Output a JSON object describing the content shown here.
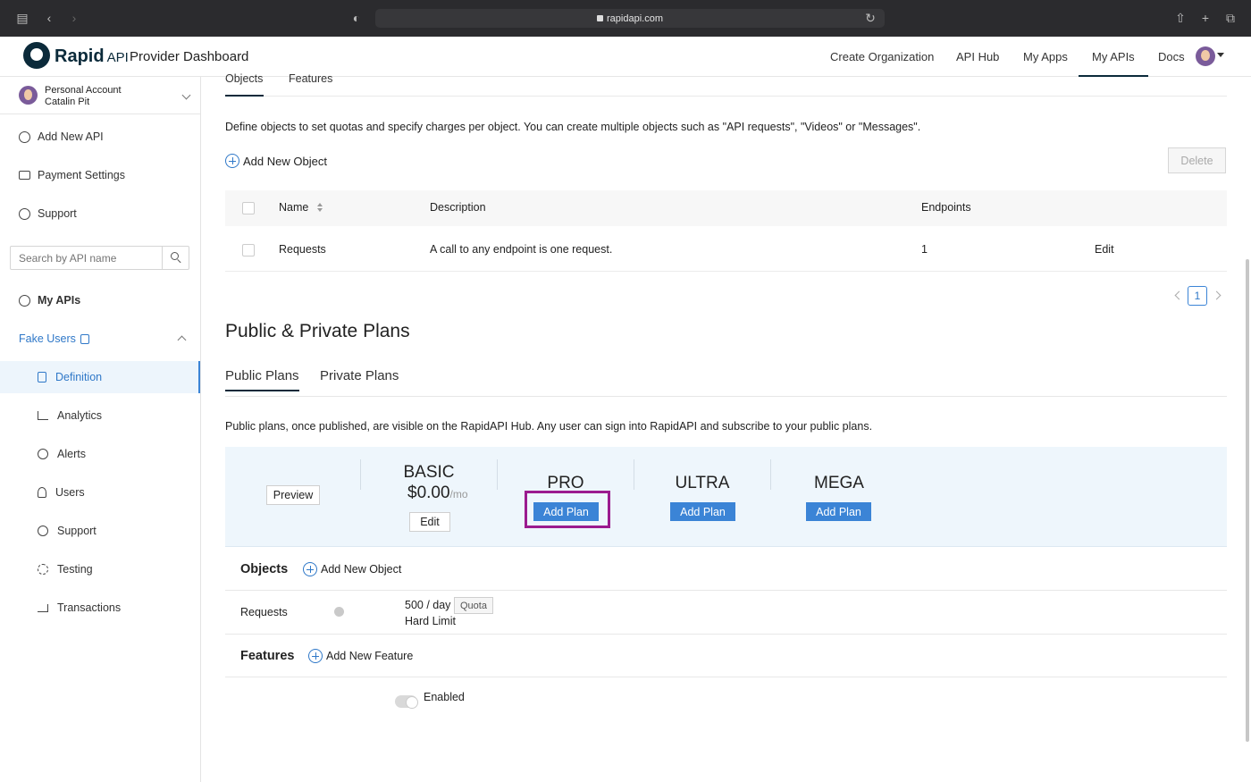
{
  "browser": {
    "url": "rapidapi.com"
  },
  "header": {
    "brand": "Rapid",
    "brand_suffix": "API",
    "title": "Provider Dashboard",
    "nav": [
      "Create Organization",
      "API Hub",
      "My Apps",
      "My APIs",
      "Docs"
    ],
    "active_nav": "My APIs"
  },
  "sidebar": {
    "account_type": "Personal Account",
    "account_name": "Catalin Pit",
    "top_items": [
      "Add New API",
      "Payment Settings",
      "Support"
    ],
    "search_placeholder": "Search by API name",
    "my_apis": "My APIs",
    "api_name": "Fake Users",
    "sub_items": [
      "Definition",
      "Analytics",
      "Alerts",
      "Users",
      "Support",
      "Testing",
      "Transactions"
    ],
    "active_sub": "Definition"
  },
  "objects_section": {
    "tabs": [
      "Objects",
      "Features"
    ],
    "description": "Define objects to set quotas and specify charges per object. You can create multiple objects such as \"API requests\", \"Videos\" or \"Messages\".",
    "add_label": "Add New Object",
    "delete_label": "Delete",
    "columns": [
      "Name",
      "Description",
      "Endpoints"
    ],
    "rows": [
      {
        "name": "Requests",
        "description": "A call to any endpoint is one request.",
        "endpoints": "1",
        "action": "Edit"
      }
    ],
    "page": "1"
  },
  "plans_section": {
    "title": "Public & Private Plans",
    "tabs": [
      "Public Plans",
      "Private Plans"
    ],
    "active_tab": "Public Plans",
    "description": "Public plans, once published, are visible on the RapidAPI Hub. Any user can sign into RapidAPI and subscribe to your public plans.",
    "preview_label": "Preview",
    "plans": [
      {
        "name": "BASIC",
        "price": "$0.00",
        "period": "/mo",
        "button": "Edit"
      },
      {
        "name": "PRO",
        "button": "Add Plan"
      },
      {
        "name": "ULTRA",
        "button": "Add Plan"
      },
      {
        "name": "MEGA",
        "button": "Add Plan"
      }
    ],
    "highlight_color": "#9b1b8f",
    "objects_heading": "Objects",
    "add_object_label": "Add New Object",
    "object_row": {
      "name": "Requests",
      "limit": "500 / day",
      "badge": "Quota",
      "type": "Hard Limit"
    },
    "features_heading": "Features",
    "add_feature_label": "Add New Feature",
    "feature_toggle_label": "Enabled"
  },
  "colors": {
    "accent": "#3b84d6",
    "link": "#2f78c8",
    "brand_dark": "#0b2a3a"
  }
}
